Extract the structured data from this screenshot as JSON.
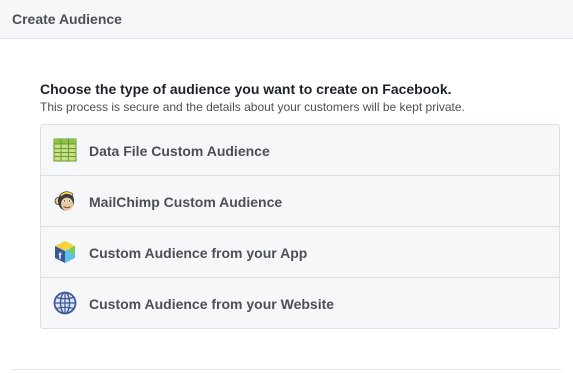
{
  "dialog": {
    "title": "Create Audience"
  },
  "intro": {
    "heading": "Choose the type of audience you want to create on Facebook.",
    "subheading": "This process is secure and the details about your customers will be kept private."
  },
  "options": [
    {
      "label": "Data File Custom Audience",
      "icon": "spreadsheet-icon"
    },
    {
      "label": "MailChimp Custom Audience",
      "icon": "mailchimp-icon"
    },
    {
      "label": "Custom Audience from your App",
      "icon": "app-cube-icon"
    },
    {
      "label": "Custom Audience from your Website",
      "icon": "globe-icon"
    }
  ],
  "colors": {
    "header_bg": "#f6f7f9",
    "option_bg": "#f6f7f9",
    "text_dark": "#1d2129",
    "text_muted": "#4b4f56"
  }
}
